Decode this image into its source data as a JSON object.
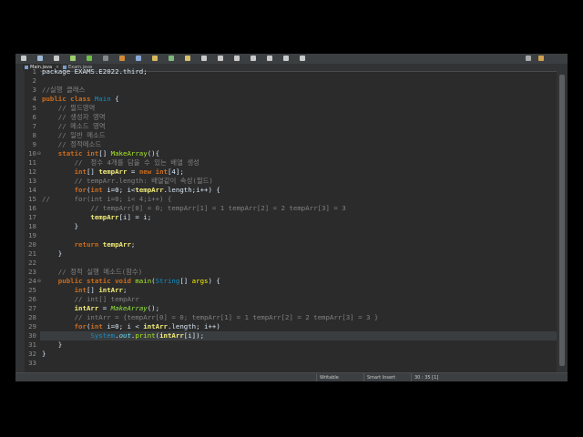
{
  "colors": {
    "background": "#2b2b2b",
    "keyword": "#cc6c1d",
    "comment": "#808080",
    "method": "#a7ec21",
    "variable": "#f3ec79",
    "class": "#1290c3"
  },
  "toolbar": {
    "icons": [
      "new-icon",
      "save-icon",
      "print-icon",
      "debug-icon",
      "run-icon",
      "run-dropdown-icon",
      "external-tools-icon",
      "new-java-project-icon",
      "new-package-icon",
      "new-class-icon",
      "open-type-icon",
      "search-icon",
      "next-annotation-icon",
      "previous-annotation-icon",
      "last-edit-icon",
      "back-icon",
      "forward-icon",
      "pin-icon",
      "perspective-icon",
      "java-perspective-icon"
    ]
  },
  "tabs": [
    {
      "label": "Main.java",
      "active": true
    },
    {
      "label": "Exam.java",
      "active": false
    }
  ],
  "editor": {
    "cursor_line": 30,
    "lines": [
      {
        "n": "1",
        "tokens": [
          [
            "package EXAMS.E2022.third;",
            "pkg"
          ]
        ]
      },
      {
        "n": "2",
        "tokens": []
      },
      {
        "n": "3",
        "tokens": [
          [
            "//실행 클래스",
            "cm"
          ]
        ]
      },
      {
        "n": "4",
        "tokens": [
          [
            "public class ",
            "kw"
          ],
          [
            "Main",
            "cls"
          ],
          [
            " {",
            ""
          ]
        ]
      },
      {
        "n": "5",
        "tokens": [
          [
            "    // 필드영역",
            "cm"
          ]
        ]
      },
      {
        "n": "6",
        "tokens": [
          [
            "    // 생성자 영역",
            "cm"
          ]
        ]
      },
      {
        "n": "7",
        "tokens": [
          [
            "    // 메소드 영역",
            "cm"
          ]
        ]
      },
      {
        "n": "8",
        "tokens": [
          [
            "    // 일반 메소드",
            "cm"
          ]
        ]
      },
      {
        "n": "9",
        "tokens": [
          [
            "    // 정적메소드",
            "cm"
          ]
        ]
      },
      {
        "n": "10",
        "fold": true,
        "tokens": [
          [
            "    static int",
            "kw"
          ],
          [
            "[] ",
            ""
          ],
          [
            "MakeArray",
            "mth"
          ],
          [
            "(){",
            ""
          ]
        ]
      },
      {
        "n": "11",
        "tokens": [
          [
            "        //  정수 4개를 담을 수 있는 배열 생성",
            "cm"
          ]
        ]
      },
      {
        "n": "12",
        "tokens": [
          [
            "        int",
            "kw"
          ],
          [
            "[] ",
            ""
          ],
          [
            "tempArr",
            "var"
          ],
          [
            " = ",
            ""
          ],
          [
            "new int",
            "kw"
          ],
          [
            "[4];",
            ""
          ]
        ]
      },
      {
        "n": "13",
        "tokens": [
          [
            "        // tempArr.length: 배열같이 속성(필드)",
            "cm"
          ]
        ]
      },
      {
        "n": "14",
        "tokens": [
          [
            "        for",
            "kw"
          ],
          [
            "(",
            ""
          ],
          [
            "int",
            "kw"
          ],
          [
            " i=0; i<",
            ""
          ],
          [
            "tempArr",
            "var"
          ],
          [
            ".length;i++) {",
            ""
          ]
        ]
      },
      {
        "n": "15",
        "tokens": [
          [
            "//      for(int i=0; i< 4;i++) {",
            "cm"
          ]
        ]
      },
      {
        "n": "16",
        "tokens": [
          [
            "            // tempArr[0] = 0; tempArr[1] = 1 tempArr[2] = 2 tempArr[3] = 3",
            "cm"
          ]
        ]
      },
      {
        "n": "17",
        "tokens": [
          [
            "            ",
            ""
          ],
          [
            "tempArr",
            "var"
          ],
          [
            "[i] = i;",
            ""
          ]
        ]
      },
      {
        "n": "18",
        "tokens": [
          [
            "        }",
            ""
          ]
        ]
      },
      {
        "n": "19",
        "tokens": []
      },
      {
        "n": "20",
        "tokens": [
          [
            "        return ",
            "kw"
          ],
          [
            "tempArr",
            "var"
          ],
          [
            ";",
            ""
          ]
        ]
      },
      {
        "n": "21",
        "tokens": [
          [
            "    }",
            ""
          ]
        ]
      },
      {
        "n": "22",
        "tokens": []
      },
      {
        "n": "23",
        "tokens": [
          [
            "    // 정적 실행 메소드(함수)",
            "cm"
          ]
        ]
      },
      {
        "n": "24",
        "fold": true,
        "tokens": [
          [
            "    public static void ",
            "kw"
          ],
          [
            "main",
            "mth"
          ],
          [
            "(",
            ""
          ],
          [
            "String",
            "cls"
          ],
          [
            "[] ",
            ""
          ],
          [
            "args",
            "loc"
          ],
          [
            ") {",
            ""
          ]
        ]
      },
      {
        "n": "25",
        "tokens": [
          [
            "        int",
            "kw"
          ],
          [
            "[] ",
            ""
          ],
          [
            "intArr",
            "var"
          ],
          [
            ";",
            ""
          ]
        ]
      },
      {
        "n": "26",
        "tokens": [
          [
            "        // int[] tempArr",
            "cm"
          ]
        ]
      },
      {
        "n": "27",
        "tokens": [
          [
            "        ",
            ""
          ],
          [
            "intArr",
            "var"
          ],
          [
            " = ",
            ""
          ],
          [
            "MakeArray",
            "mthi"
          ],
          [
            "();",
            ""
          ]
        ]
      },
      {
        "n": "28",
        "tokens": [
          [
            "        // intArr = {tempArr[0] = 0; tempArr[1] = 1 tempArr[2] = 2 tempArr[3] = 3 }",
            "cm"
          ]
        ]
      },
      {
        "n": "29",
        "tokens": [
          [
            "        for",
            "kw"
          ],
          [
            "(",
            ""
          ],
          [
            "int",
            "kw"
          ],
          [
            " i=0; i < ",
            ""
          ],
          [
            "intArr",
            "var"
          ],
          [
            ".length; i++)",
            ""
          ]
        ]
      },
      {
        "n": "30",
        "tokens": [
          [
            "            ",
            ""
          ],
          [
            "System",
            "sys"
          ],
          [
            ".",
            ""
          ],
          [
            "out",
            "fld"
          ],
          [
            ".",
            ""
          ],
          [
            "print",
            "mth"
          ],
          [
            "(",
            ""
          ],
          [
            "intArr",
            "var"
          ],
          [
            "[i]);",
            ""
          ]
        ]
      },
      {
        "n": "31",
        "tokens": [
          [
            "    }",
            ""
          ]
        ]
      },
      {
        "n": "32",
        "tokens": [
          [
            "}",
            ""
          ]
        ]
      },
      {
        "n": "33",
        "tokens": []
      }
    ]
  },
  "status": {
    "writable": "Writable",
    "insert_mode": "Smart Insert",
    "position": "30 : 35 [1]"
  }
}
